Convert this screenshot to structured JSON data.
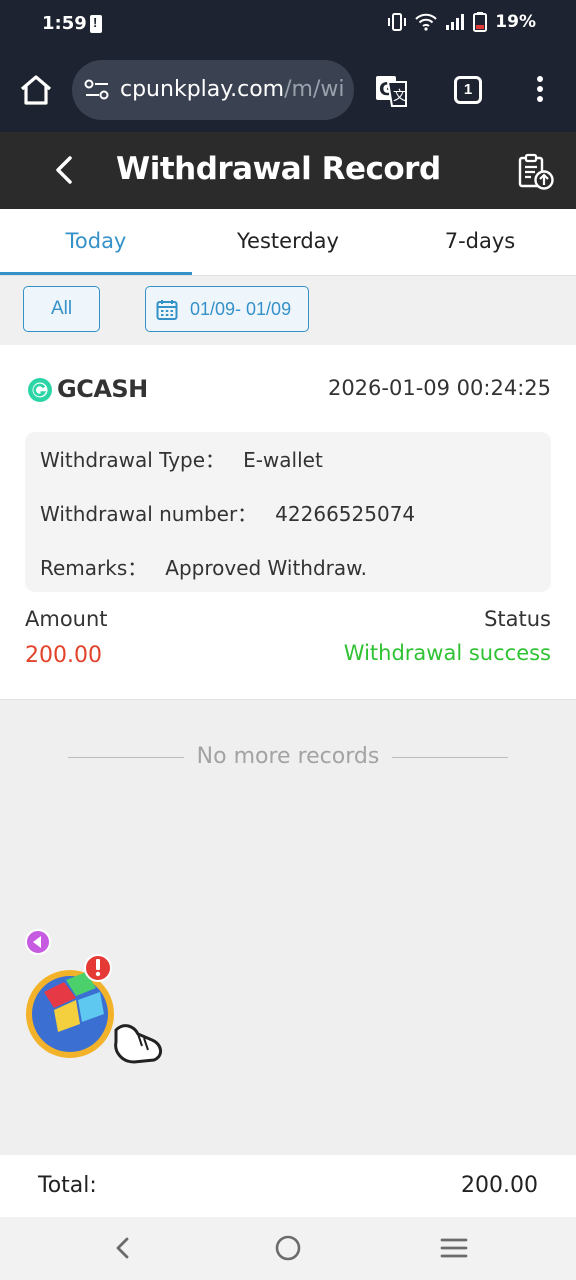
{
  "status_bar": {
    "time": "1:59",
    "battery": "19%"
  },
  "browser": {
    "url_main": "cpunkplay.com",
    "url_path": "/m/wi",
    "tab_count": "1"
  },
  "header": {
    "title": "Withdrawal Record"
  },
  "tabs": [
    {
      "label": "Today",
      "active": true
    },
    {
      "label": "Yesterday",
      "active": false
    },
    {
      "label": "7-days",
      "active": false
    }
  ],
  "filter": {
    "all_label": "All",
    "date_range": "01/09- 01/09"
  },
  "record": {
    "method": "GCASH",
    "datetime": "2026-01-09 00:24:25",
    "type_label": "Withdrawal Type：",
    "type_value": "E-wallet",
    "number_label": "Withdrawal number：",
    "number_value": "42266525074",
    "remarks_label": "Remarks：",
    "remarks_value": "Approved Withdraw.",
    "amount_label": "Amount",
    "amount_value": "200.00",
    "status_label": "Status",
    "status_value": "Withdrawal success"
  },
  "list_end": "No more records",
  "total": {
    "label": "Total:",
    "value": "200.00"
  },
  "colors": {
    "accent": "#3592c9",
    "amount": "#e2432a",
    "success": "#2fc232",
    "header_bg": "#2b2b2b",
    "system_bg": "#1d2330"
  },
  "icons": [
    "home-icon",
    "site-settings-icon",
    "translate-icon",
    "tabs-icon",
    "more-vert-icon",
    "back-arrow-icon",
    "record-upload-icon",
    "calendar-icon",
    "gcash-logo-icon",
    "collapse-arrow-icon",
    "game-cube-icon",
    "nav-back-icon",
    "nav-home-icon",
    "nav-recents-icon"
  ]
}
